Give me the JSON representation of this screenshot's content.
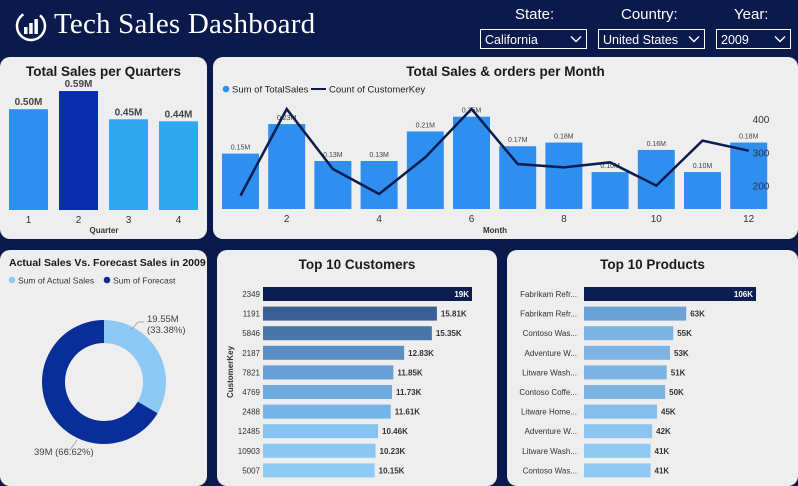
{
  "header": {
    "title": "Tech Sales Dashboard",
    "logo_icon": "bar-chart-circle-icon"
  },
  "filters": [
    {
      "label": "State:",
      "value": "California"
    },
    {
      "label": "Country:",
      "value": "United States"
    },
    {
      "label": "Year:",
      "value": "2009"
    }
  ],
  "colors": {
    "background": "#0a1a4d",
    "panel": "#eeeeee",
    "bar_blue": "#2e8ff0",
    "bar_highlight": "#0a2db0",
    "bar_light": "#2fa8f0",
    "line": "#0b1d4f",
    "donut_actual": "#8ec8f5",
    "donut_forecast": "#0a2e99"
  },
  "chart_data": [
    {
      "id": "quarters",
      "type": "bar",
      "title": "Total Sales per Quarters",
      "xlabel": "Quarter",
      "categories": [
        "1",
        "2",
        "3",
        "4"
      ],
      "values": [
        0.5,
        0.59,
        0.45,
        0.44
      ],
      "value_labels": [
        "0.50M",
        "0.59M",
        "0.45M",
        "0.44M"
      ],
      "ylim": [
        0,
        0.62
      ]
    },
    {
      "id": "monthly",
      "type": "bar+line",
      "title": "Total Sales & orders per Month",
      "xlabel": "Month",
      "legend": [
        "Sum of TotalSales",
        "Count of CustomerKey"
      ],
      "legend_position": "top-left",
      "x": [
        1,
        2,
        3,
        4,
        5,
        6,
        7,
        8,
        9,
        10,
        11,
        12
      ],
      "x_tick_labels": [
        "2",
        "4",
        "6",
        "8",
        "10",
        "12"
      ],
      "series": [
        {
          "name": "Sum of TotalSales",
          "values": [
            0.15,
            0.23,
            0.13,
            0.13,
            0.21,
            0.25,
            0.17,
            0.18,
            0.1,
            0.16,
            0.1,
            0.18
          ],
          "labels": [
            "0.15M",
            "0.23M",
            "0.13M",
            "0.13M",
            "0.21M",
            "0.25M",
            "0.17M",
            "0.18M",
            "0.10M",
            "0.16M",
            "0.10M",
            "0.18M"
          ]
        },
        {
          "name": "Count of CustomerKey",
          "axis": "right",
          "values": [
            170,
            430,
            250,
            175,
            285,
            430,
            265,
            255,
            270,
            200,
            335,
            305
          ]
        }
      ],
      "ylim": [
        0,
        0.26
      ],
      "y2lim": [
        130,
        430
      ],
      "y2_ticks": [
        "400",
        "300",
        "200"
      ]
    },
    {
      "id": "forecast",
      "type": "pie",
      "title": "Actual Sales Vs. Forecast Sales in 2009",
      "legend": [
        "Sum of Actual Sales",
        "Sum of Forecast"
      ],
      "legend_position": "top-left",
      "slices": [
        {
          "name": "Sum of Actual Sales",
          "value": 19.55,
          "label": "19.55M",
          "pct": "(33.38%)"
        },
        {
          "name": "Sum of Forecast",
          "value": 39,
          "label": "39M (66.62%)"
        }
      ]
    },
    {
      "id": "customers",
      "type": "bar",
      "orientation": "horizontal",
      "title": "Top 10 Customers",
      "ylabel": "CustomerKey",
      "categories": [
        "2349",
        "1191",
        "5846",
        "2187",
        "7821",
        "4769",
        "2488",
        "12485",
        "10903",
        "5007"
      ],
      "values": [
        19,
        15.81,
        15.35,
        12.83,
        11.85,
        11.73,
        11.61,
        10.46,
        10.23,
        10.15
      ],
      "value_labels": [
        "19K",
        "15.81K",
        "15.35K",
        "12.83K",
        "11.85K",
        "11.73K",
        "11.61K",
        "10.46K",
        "10.23K",
        "10.15K"
      ]
    },
    {
      "id": "products",
      "type": "bar",
      "orientation": "horizontal",
      "title": "Top 10 Products",
      "categories": [
        "Fabrikam Refr...",
        "Fabrikam Refr...",
        "Contoso Was...",
        "Adventure W...",
        "Litware Wash...",
        "Contoso Coffe...",
        "Litware Home...",
        "Adventure W...",
        "Litware Wash...",
        "Contoso Was..."
      ],
      "values": [
        106,
        63,
        55,
        53,
        51,
        50,
        45,
        42,
        41,
        41
      ],
      "value_labels": [
        "106K",
        "63K",
        "55K",
        "53K",
        "51K",
        "50K",
        "45K",
        "42K",
        "41K",
        "41K"
      ]
    }
  ]
}
